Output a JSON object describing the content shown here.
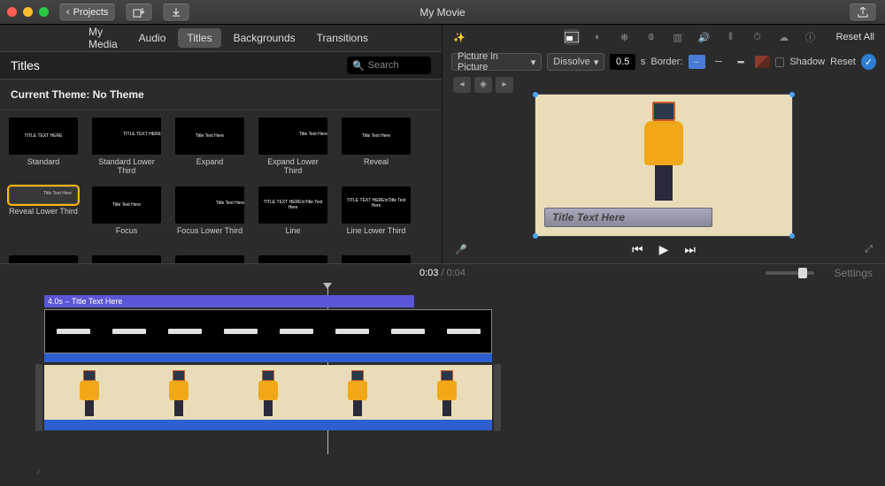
{
  "window": {
    "title": "My Movie",
    "back_label": "Projects"
  },
  "library": {
    "tabs": [
      "My Media",
      "Audio",
      "Titles",
      "Backgrounds",
      "Transitions"
    ],
    "active_tab": "Titles",
    "section_title": "Titles",
    "search_placeholder": "Search",
    "theme_line": "Current Theme: No Theme",
    "items": [
      {
        "label": "Standard",
        "preview": "TITLE TEXT HERE"
      },
      {
        "label": "Standard Lower Third",
        "preview": "TITLE TEXT HERE"
      },
      {
        "label": "Expand",
        "preview": "Title Text Here"
      },
      {
        "label": "Expand Lower Third",
        "preview": "Title Text Here"
      },
      {
        "label": "Reveal",
        "preview": "Title Text Here"
      },
      {
        "label": "Reveal Lower Third",
        "preview": "Title Text Here",
        "selected": true
      },
      {
        "label": "Focus",
        "preview": "Title Text Here"
      },
      {
        "label": "Focus Lower Third",
        "preview": "Title Text Here"
      },
      {
        "label": "Line",
        "preview": "TITLE TEXT HERE\\nTitle Text Here"
      },
      {
        "label": "Line Lower Third",
        "preview": "TITLE TEXT HERE\\nTitle Text Here"
      }
    ]
  },
  "inspector": {
    "reset_all": "Reset All",
    "overlay_mode": "Picture in Picture",
    "transition": "Dissolve",
    "duration": "0.5",
    "duration_unit": "s",
    "border_label": "Border:",
    "shadow_label": "Shadow",
    "reset_label": "Reset"
  },
  "viewer": {
    "title_text": "Title Text Here"
  },
  "playback": {
    "current": "0:03",
    "duration": "0:04",
    "settings_label": "Settings"
  },
  "timeline": {
    "title_clip_label": "4.0s – Title Text Here"
  }
}
